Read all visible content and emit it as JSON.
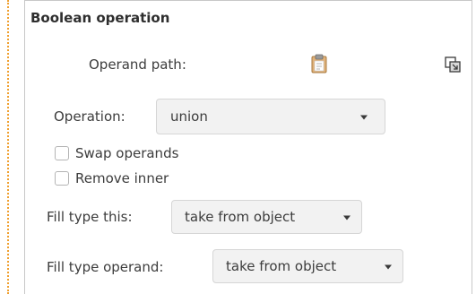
{
  "section": {
    "title": "Boolean operation"
  },
  "operand": {
    "label": "Operand path:",
    "paste_icon": "clipboard-paste-icon",
    "select_icon": "select-original-icon"
  },
  "operation": {
    "label": "Operation:",
    "value": "union"
  },
  "options": {
    "swap_label": "Swap operands",
    "swap_checked": false,
    "remove_label": "Remove inner",
    "remove_checked": false
  },
  "fill_this": {
    "label": "Fill type this:",
    "value": "take from object"
  },
  "fill_operand": {
    "label": "Fill type operand:",
    "value": "take from object"
  },
  "colors": {
    "dotted_edge": "#f0a030",
    "clipboard_body": "#e0b27a",
    "dropdown_bg": "#f2f2f2"
  }
}
